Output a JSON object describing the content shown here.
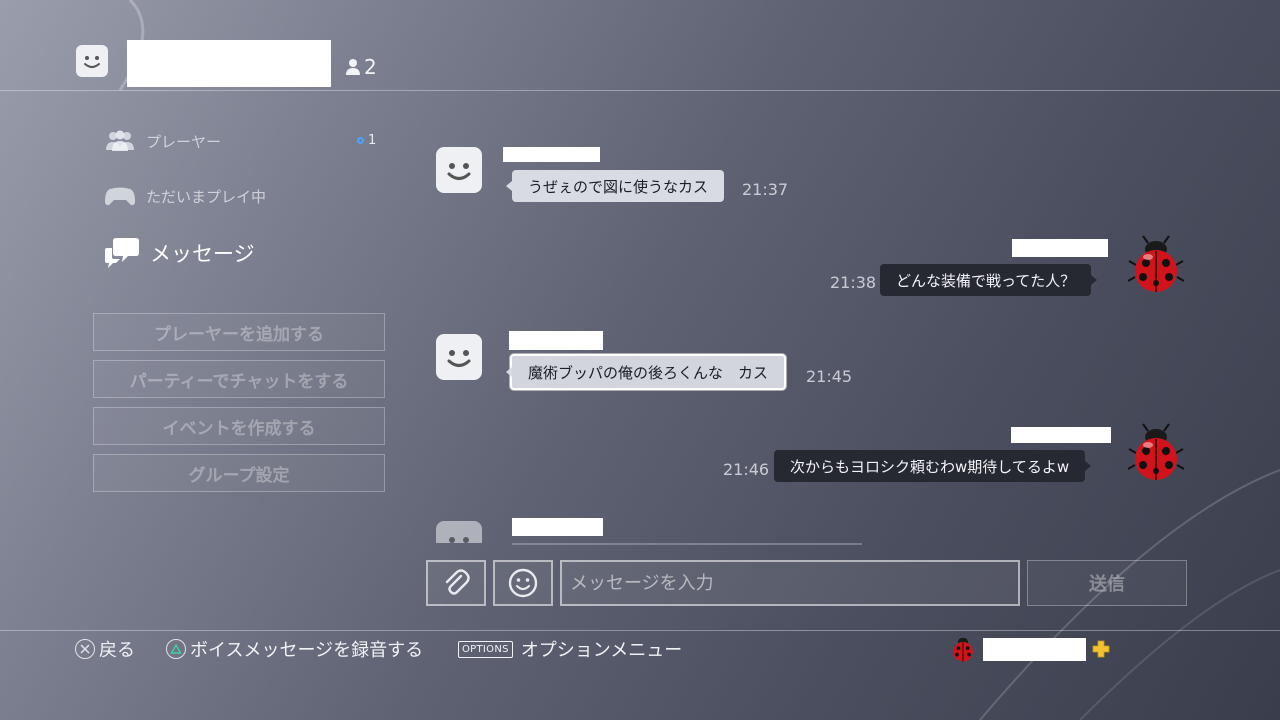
{
  "header": {
    "member_count": "2"
  },
  "sidebar": {
    "items": [
      {
        "label": "プレーヤー",
        "badge": "1"
      },
      {
        "label": "ただいまプレイ中"
      },
      {
        "label": "メッセージ"
      }
    ],
    "actions": [
      {
        "label": "プレーヤーを追加する"
      },
      {
        "label": "パーティーでチャットをする"
      },
      {
        "label": "イベントを作成する"
      },
      {
        "label": "グループ設定"
      }
    ]
  },
  "messages": [
    {
      "direction": "in",
      "text": "うぜぇので図に使うなカス",
      "time": "21:37"
    },
    {
      "direction": "out",
      "text": "どんな装備で戦ってた人？",
      "time": "21:38"
    },
    {
      "direction": "in",
      "text": "魔術ブッパの俺の後ろくんな　カス",
      "time": "21:45",
      "selected": true
    },
    {
      "direction": "out",
      "text": "次からもヨロシク頼むわw期待してるよw",
      "time": "21:46"
    }
  ],
  "composer": {
    "placeholder": "メッセージを入力",
    "attach_icon": "paperclip-icon",
    "emoji_icon": "smiley-icon",
    "send_label": "送信"
  },
  "footer": {
    "back_label": "戻る",
    "voice_label": "ボイスメッセージを録音する",
    "options_key": "OPTIONS",
    "options_label": "オプションメニュー"
  },
  "colors": {
    "bubble_in": "#d9dbe2",
    "bubble_out": "#262832",
    "badge_dot": "#4aa3ff",
    "plus_icon": "#f2c230"
  }
}
